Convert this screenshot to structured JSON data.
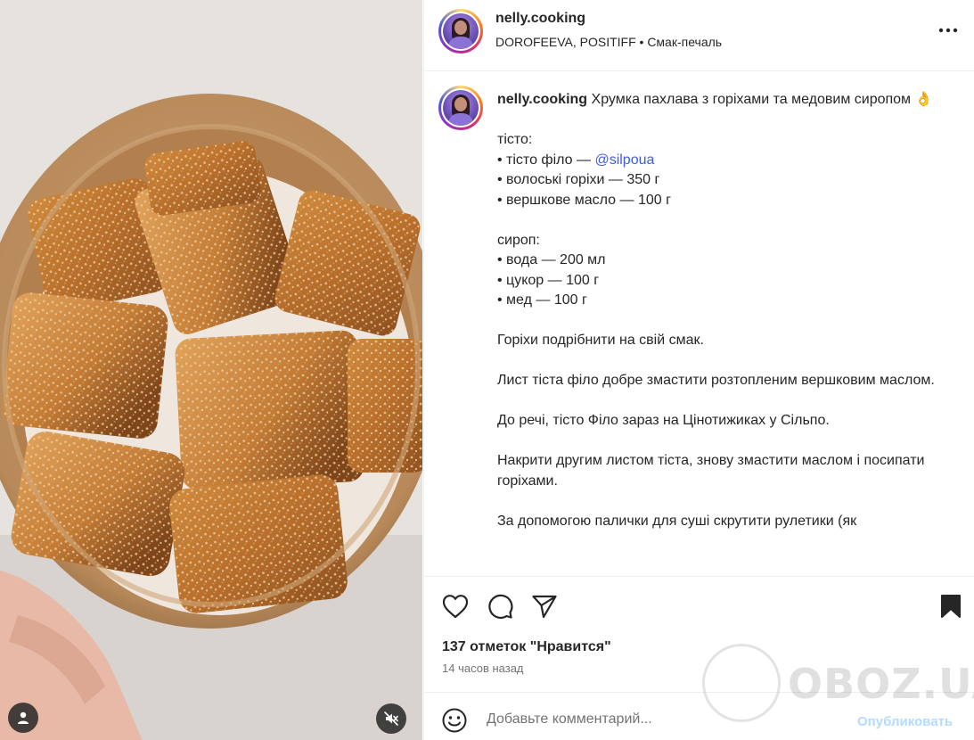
{
  "post": {
    "username": "nelly.cooking",
    "audio": "DOROFEEVA, POSITIFF • Смак-печаль"
  },
  "caption": {
    "username": "nelly.cooking",
    "lines": [
      "Хрумка пахлава з горіхами та медовим сиропом",
      "",
      "тісто:",
      "• тісто філо — ",
      "• волоські горіхи — 350 г",
      "• вершкове масло — 100 г",
      "",
      "сироп:",
      "• вода — 200 мл",
      "• цукор — 100 г",
      "• мед — 100 г",
      "",
      "Горіхи подрібнити на свій смак.",
      "",
      "Лист тіста філо добре змастити розтопленим вершковим маслом.",
      "",
      "До речі, тісто Філо зараз на Цінотижиках у Сільпо.",
      "",
      "Накрити другим листом тіста, знову змастити маслом і посипати горіхами.",
      "",
      "За допомогою палички для суші скрутити рулетики (як"
    ],
    "mention": "@silpoua",
    "title_emoji": "👌"
  },
  "actions": {
    "likes": "137 отметок \"Нравится\"",
    "time_ago": "14 часов назад"
  },
  "comment": {
    "placeholder": "Добавьте комментарий...",
    "post_label": "Опубликовать"
  },
  "watermark": {
    "text": "OBOZ.UA"
  },
  "icons": {
    "like": "heart-icon",
    "comment": "comment-bubble-icon",
    "share": "paper-plane-icon",
    "save": "bookmark-filled-icon",
    "more": "more-horizontal-icon",
    "emoji": "smiley-icon",
    "user_tag": "user-icon",
    "mute": "speaker-muted-icon"
  },
  "colors": {
    "mention": "#3d5ce0",
    "post_disabled": "#b3dbff",
    "secondary_text": "#737373"
  }
}
